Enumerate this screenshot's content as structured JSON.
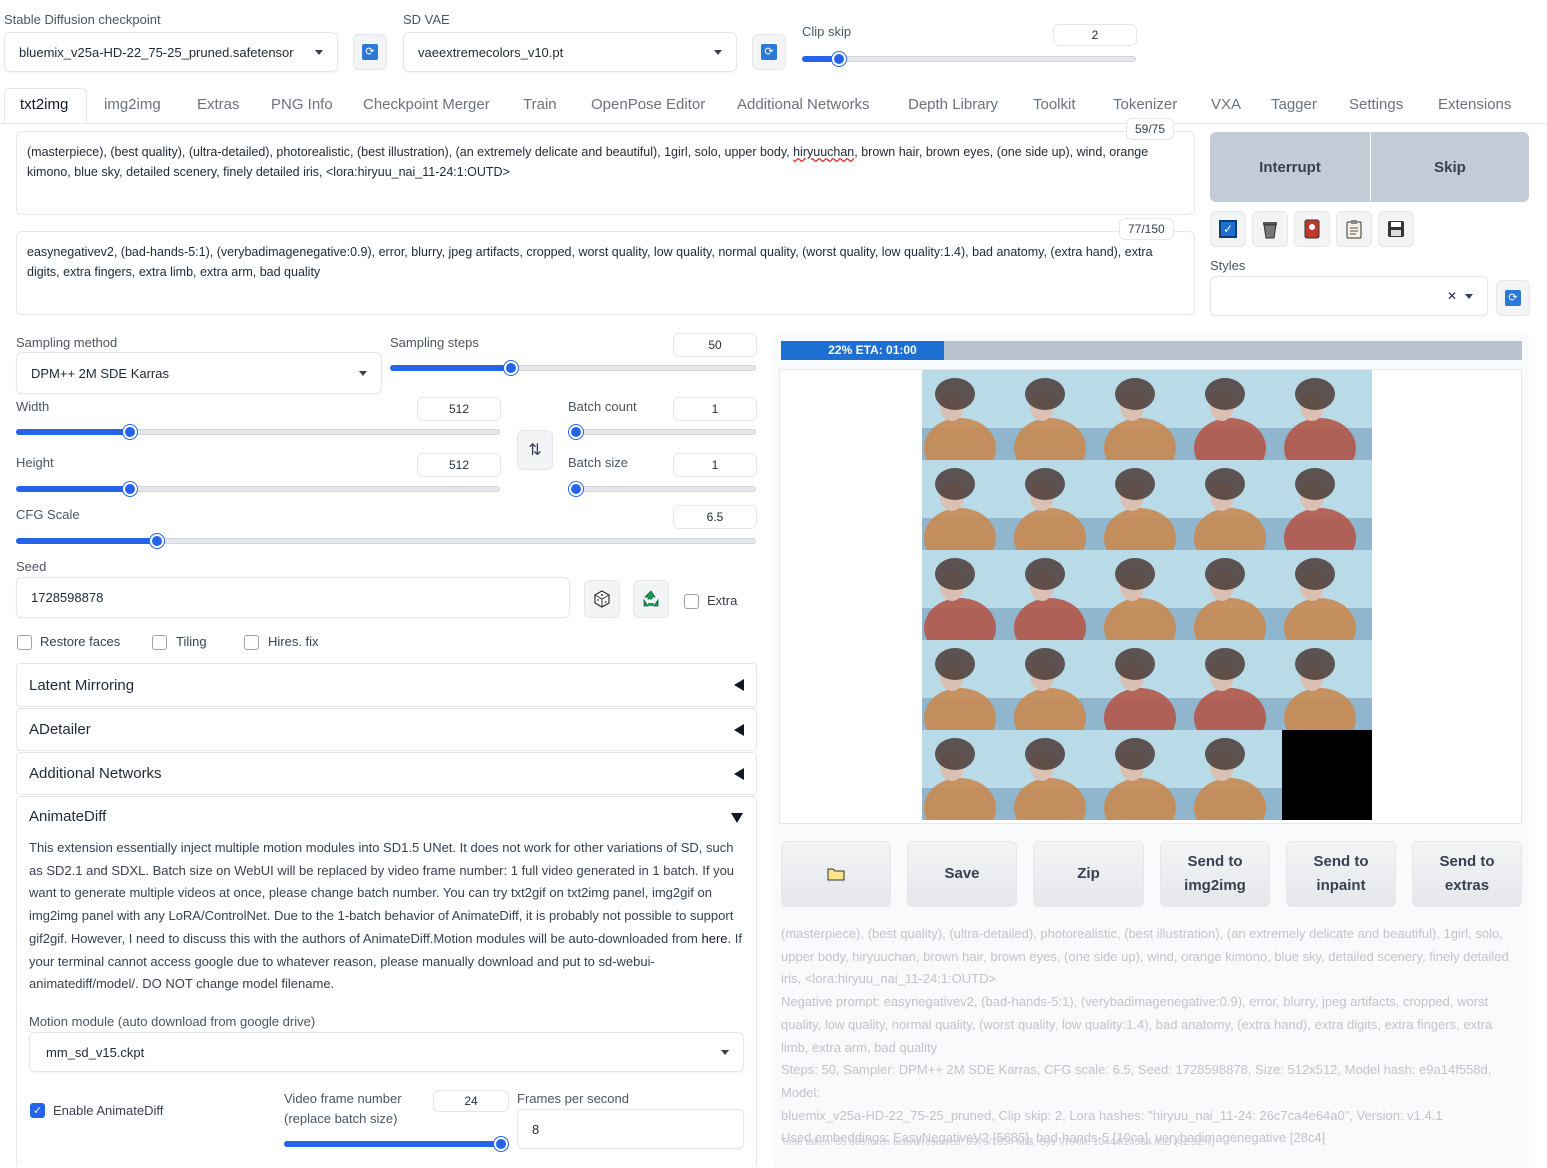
{
  "checkpoint": {
    "label": "Stable Diffusion checkpoint",
    "value": "bluemix_v25a-HD-22_75-25_pruned.safetensor"
  },
  "vae": {
    "label": "SD VAE",
    "value": "vaeextremecolors_v10.pt"
  },
  "clip_skip": {
    "label": "Clip skip",
    "value": "2",
    "fraction": 0.107
  },
  "tabs": [
    "txt2img",
    "img2img",
    "Extras",
    "PNG Info",
    "Checkpoint Merger",
    "Train",
    "OpenPose Editor",
    "Additional Networks",
    "Depth Library",
    "Toolkit",
    "Tokenizer",
    "VXA",
    "Tagger",
    "Settings",
    "Extensions"
  ],
  "active_tab": "txt2img",
  "prompt": {
    "counter": "59/75",
    "text_before": "(masterpiece), (best quality), (ultra-detailed), photorealistic, (best illustration), (an extremely delicate and beautiful), 1girl, solo, upper body, ",
    "text_underlined": "hiryuuchan",
    "text_after": ", brown hair, brown eyes, (one side up), wind, orange kimono, blue sky, detailed scenery, finely detailed iris, <lora:hiryuu_nai_11-24:1:OUTD>"
  },
  "negative_prompt": {
    "counter": "77/150",
    "text": "easynegativev2, (bad-hands-5:1), (verybadimagenegative:0.9), error, blurry, jpeg artifacts, cropped, worst quality, low quality, normal quality, (worst quality, low quality:1.4), bad anatomy, (extra hand), extra digits, extra fingers, extra limb, extra arm, bad quality"
  },
  "buttons": {
    "interrupt": "Interrupt",
    "skip": "Skip"
  },
  "tool_icons": [
    "checkbox-icon",
    "trash-icon",
    "red-card-icon",
    "clipboard-icon",
    "save-icon"
  ],
  "styles": {
    "label": "Styles",
    "clear": "✕"
  },
  "sampling": {
    "method_label": "Sampling method",
    "method_value": "DPM++ 2M SDE Karras",
    "steps_label": "Sampling steps",
    "steps_value": "50",
    "steps_fraction": 0.33,
    "width_label": "Width",
    "width_value": "512",
    "width_fraction": 0.235,
    "height_label": "Height",
    "height_value": "512",
    "height_fraction": 0.235,
    "batch_count_label": "Batch count",
    "batch_count_value": "1",
    "batch_count_fraction": 0,
    "batch_size_label": "Batch size",
    "batch_size_value": "1",
    "batch_size_fraction": 0,
    "cfg_label": "CFG Scale",
    "cfg_value": "6.5",
    "cfg_fraction": 0.19,
    "swap_icon": "⇅"
  },
  "seed": {
    "label": "Seed",
    "value": "1728598878",
    "extra_label": "Extra"
  },
  "checkboxes": {
    "restore_faces": "Restore faces",
    "tiling": "Tiling",
    "hires_fix": "Hires. fix"
  },
  "accordions": [
    "Latent Mirroring",
    "ADetailer",
    "Additional Networks"
  ],
  "animatediff": {
    "title": "AnimateDiff",
    "description": "This extension essentially inject multiple motion modules into SD1.5 UNet. It does not work for other variations of SD, such as SD2.1 and SDXL. Batch size on WebUI will be replaced by video frame number: 1 full video generated in 1 batch. If you want to generate multiple videos at once, please change batch number. You can try txt2gif on txt2img panel, img2gif on img2img panel with any LoRA/ControlNet. Due to the 1-batch behavior of AnimateDiff, it is probably not possible to support gif2gif. However, I need to discuss this with the authors of AnimateDiff.Motion modules will be auto-downloaded from ",
    "link": "here",
    "description_end": ". If your terminal cannot access google due to whatever reason, please manually download and put to sd-webui-animatediff/model/. DO NOT change model filename.",
    "motion_label": "Motion module (auto download from google drive)",
    "motion_value": "mm_sd_v15.ckpt",
    "enable_label": "Enable AnimateDiff",
    "frames_label_1": "Video frame number",
    "frames_label_2": "(replace batch size)",
    "frames_value": "24",
    "frames_fraction": 1.0,
    "fps_label": "Frames per second",
    "fps_value": "8"
  },
  "progress": {
    "text": "22% ETA: 01:00",
    "fraction": 0.22
  },
  "output_buttons": {
    "folder_icon": "folder-icon",
    "save": "Save",
    "zip": "Zip",
    "send_img2img": [
      "Send to",
      "img2img"
    ],
    "send_inpaint": [
      "Send to",
      "inpaint"
    ],
    "send_extras": [
      "Send to",
      "extras"
    ]
  },
  "gen_info": {
    "lines": [
      "(masterpiece), (best quality), (ultra-detailed), photorealistic, (best illustration), (an extremely delicate and beautiful), 1girl, solo,",
      "upper body, hiryuuchan, brown hair, brown eyes, (one side up), wind, orange kimono, blue sky, detailed scenery, finely detailed",
      "iris, <lora:hiryuu_nai_11-24:1:OUTD>",
      "Negative prompt: easynegativev2, (bad-hands-5:1), (verybadimagenegative:0.9), error, blurry, jpeg artifacts, cropped, worst",
      "quality, low quality, normal quality, (worst quality, low quality:1.4), bad anatomy, (extra hand), extra digits, extra fingers, extra",
      "limb, extra arm, bad quality",
      "Steps: 50, Sampler: DPM++ 2M SDE Karras, CFG scale: 6.5, Seed: 1728598878, Size: 512x512, Model hash: e9a14f558d, Model:",
      "bluemix_v25a-HD-22_75-25_pruned, Clip skip: 2, Lora hashes: \"hiryuu_nai_11-24: 26c7ca4e64a0\", Version: v1.4.1",
      "Used embeddings: EasyNegativeV2 [5685], bad-hands-5 [10ca], verybadimagenegative [28c4]"
    ],
    "time": "Time taken: 55.60sTorch active/reserved: 6979/7654 MiB, Sys VRAM: 10444/24564 MiB (42.52%)"
  },
  "grid_colors": {
    "sky": "#b9dbe8",
    "orange": "#c98a52",
    "red": "#b4584a",
    "hair": "#4a3a36",
    "black": "#000000"
  }
}
